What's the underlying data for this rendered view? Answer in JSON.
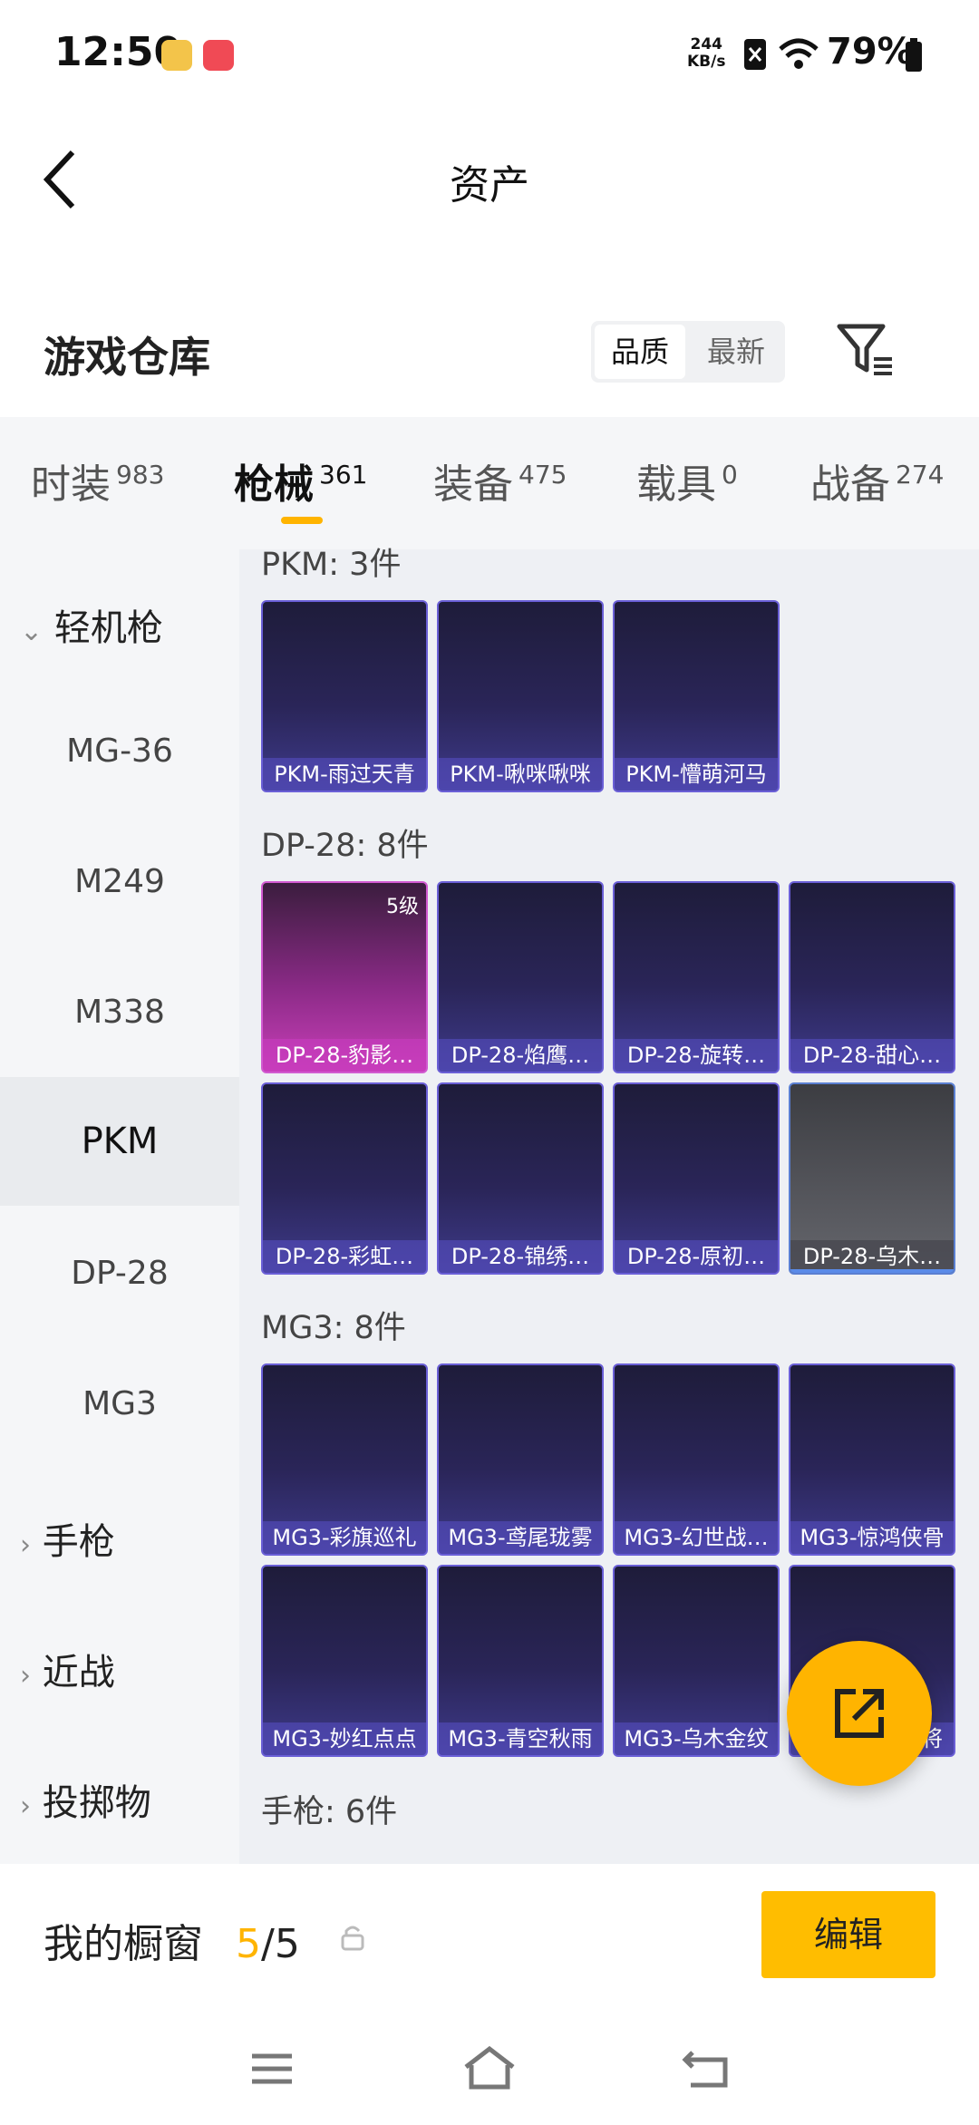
{
  "status": {
    "time": "12:50",
    "net_speed": "244",
    "net_unit": "KB/s",
    "battery": "79%"
  },
  "header": {
    "title": "资产"
  },
  "warehouse": {
    "title": "游戏仓库",
    "sort_quality": "品质",
    "sort_latest": "最新"
  },
  "tabs": [
    {
      "label": "时装",
      "count": "983"
    },
    {
      "label": "枪械",
      "count": "361"
    },
    {
      "label": "装备",
      "count": "475"
    },
    {
      "label": "载具",
      "count": "0"
    },
    {
      "label": "战备",
      "count": "274"
    }
  ],
  "sidebar": {
    "group_lmg": "轻机枪",
    "items": [
      "MG-36",
      "M249",
      "M338",
      "PKM",
      "DP-28",
      "MG3"
    ],
    "group_pistol": "手枪",
    "group_melee": "近战",
    "group_throw": "投掷物"
  },
  "sections": {
    "pkm": "PKM: 3件",
    "dp28": "DP-28: 8件",
    "mg3": "MG3: 8件",
    "pistol": "手枪: 6件"
  },
  "cards": {
    "pkm": [
      "PKM-雨过天青",
      "PKM-啾咪啾咪",
      "PKM-懵萌河马"
    ],
    "dp28_row1": [
      "DP-28-豹影…",
      "DP-28-焰鹰…",
      "DP-28-旋转…",
      "DP-28-甜心…"
    ],
    "dp28_row2": [
      "DP-28-彩虹…",
      "DP-28-锦绣…",
      "DP-28-原初…",
      "DP-28-乌木…"
    ],
    "mg3_row1": [
      "MG3-彩旗巡礼",
      "MG3-鸢尾珑雾",
      "MG3-幻世战…",
      "MG3-惊鸿侠骨"
    ],
    "mg3_row2": [
      "MG3-妙红点点",
      "MG3-青空秋雨",
      "MG3-乌木金纹",
      "将"
    ],
    "level_badge": "5级"
  },
  "bottom": {
    "title": "我的橱窗",
    "count_used": "5",
    "count_total": "/5",
    "edit_label": "编辑"
  },
  "colors": {
    "accent": "#ffb400",
    "card_border": "#6a5fd6"
  }
}
